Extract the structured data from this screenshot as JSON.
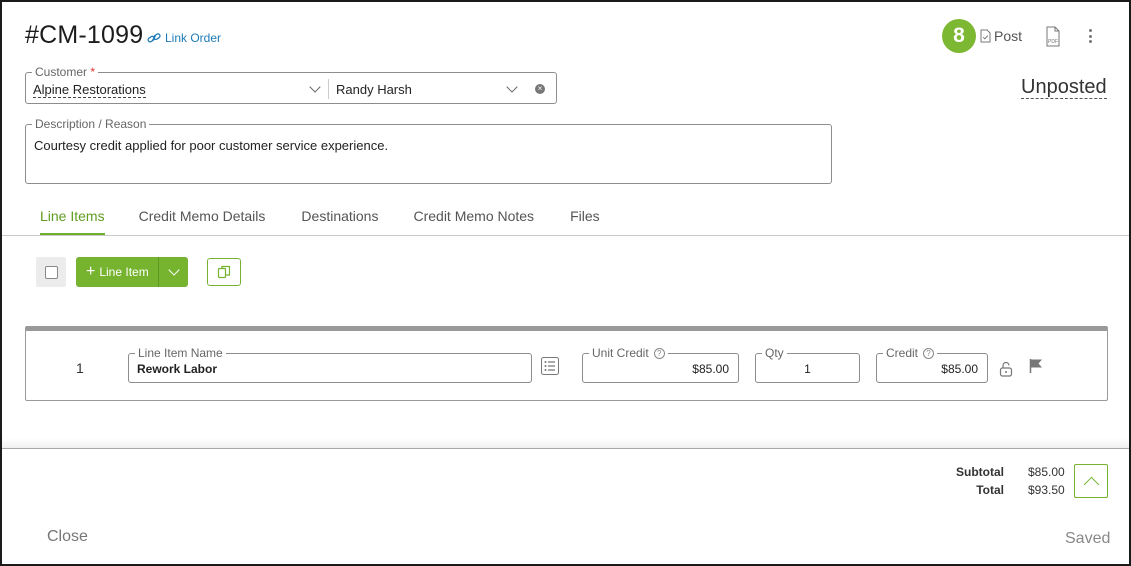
{
  "header": {
    "title": "#CM-1099",
    "link_order_label": "Link Order",
    "badge_count": "8",
    "post_label": "Post",
    "pdf_label": "PDF",
    "status": "Unposted"
  },
  "customer": {
    "label": "Customer",
    "required_mark": "*",
    "value": "Alpine Restorations",
    "contact_value": "Randy Harsh"
  },
  "description": {
    "label": "Description / Reason",
    "value": "Courtesy credit applied for poor customer service experience."
  },
  "tabs": [
    {
      "label": "Line Items",
      "active": true
    },
    {
      "label": "Credit Memo Details",
      "active": false
    },
    {
      "label": "Destinations",
      "active": false
    },
    {
      "label": "Credit Memo Notes",
      "active": false
    },
    {
      "label": "Files",
      "active": false
    }
  ],
  "toolbar": {
    "add_line_item_label": "Line Item"
  },
  "line_items": [
    {
      "number": "1",
      "name_label": "Line Item Name",
      "name": "Rework Labor",
      "unit_credit_label": "Unit Credit",
      "unit_credit": "$85.00",
      "qty_label": "Qty",
      "qty": "1",
      "credit_label": "Credit",
      "credit": "$85.00"
    }
  ],
  "totals": {
    "subtotal_label": "Subtotal",
    "subtotal": "$85.00",
    "total_label": "Total",
    "total": "$93.50"
  },
  "footer": {
    "close_label": "Close",
    "saved_label": "Saved"
  },
  "colors": {
    "accent": "#76b32f",
    "link": "#1f7bb8"
  }
}
